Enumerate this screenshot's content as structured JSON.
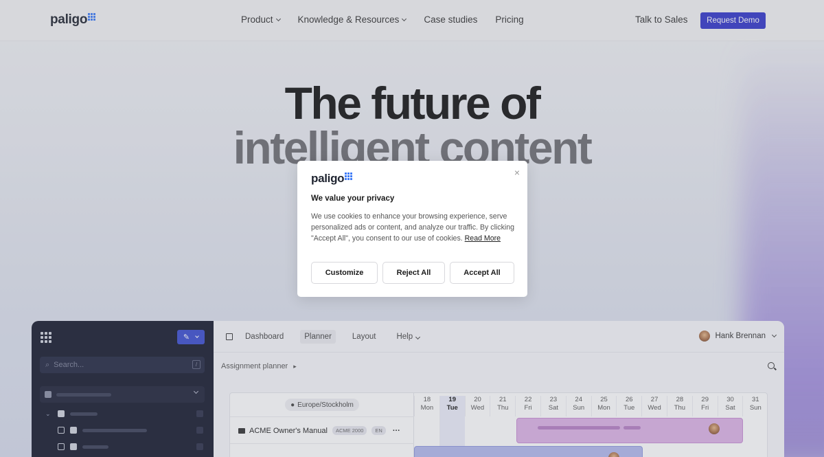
{
  "brand": {
    "name": "paligo",
    "accent": "#3d7bf7"
  },
  "nav": {
    "items": [
      {
        "label": "Product",
        "has_dropdown": true
      },
      {
        "label": "Knowledge & Resources",
        "has_dropdown": true
      },
      {
        "label": "Case studies",
        "has_dropdown": false
      },
      {
        "label": "Pricing",
        "has_dropdown": false
      }
    ],
    "talk_label": "Talk to Sales",
    "demo_label": "Request Demo",
    "demo_color": "#3237c9"
  },
  "hero": {
    "line1": "The future of",
    "line2": "intelligent content"
  },
  "preview": {
    "search_placeholder": "Search...",
    "search_shortcut": "/",
    "tabs": [
      "Dashboard",
      "Planner",
      "Layout",
      "Help"
    ],
    "active_tab": "Planner",
    "user_name": "Hank Brennan",
    "breadcrumb": "Assignment planner",
    "timezone": "Europe/Stockholm",
    "row_title": "ACME Owner's Manual",
    "row_tag": "ACME 2000",
    "row_lang": "EN",
    "row_more": "···",
    "days": [
      {
        "num": "18",
        "name": "Mon"
      },
      {
        "num": "19",
        "name": "Tue",
        "today": true
      },
      {
        "num": "20",
        "name": "Wed"
      },
      {
        "num": "21",
        "name": "Thu"
      },
      {
        "num": "22",
        "name": "Fri"
      },
      {
        "num": "23",
        "name": "Sat"
      },
      {
        "num": "24",
        "name": "Sun"
      },
      {
        "num": "25",
        "name": "Mon"
      },
      {
        "num": "26",
        "name": "Tue"
      },
      {
        "num": "27",
        "name": "Wed"
      },
      {
        "num": "28",
        "name": "Thu"
      },
      {
        "num": "29",
        "name": "Fri"
      },
      {
        "num": "30",
        "name": "Sat"
      },
      {
        "num": "31",
        "name": "Sun"
      }
    ]
  },
  "cookie_modal": {
    "brand": "paligo",
    "title": "We value your privacy",
    "body": "We use cookies to enhance your browsing experience, serve personalized ads or content, and analyze our traffic. By clicking \"Accept All\", you consent to our use of cookies.",
    "read_more": "Read More",
    "close_glyph": "×",
    "buttons": {
      "customize": "Customize",
      "reject": "Reject All",
      "accept": "Accept All"
    }
  }
}
